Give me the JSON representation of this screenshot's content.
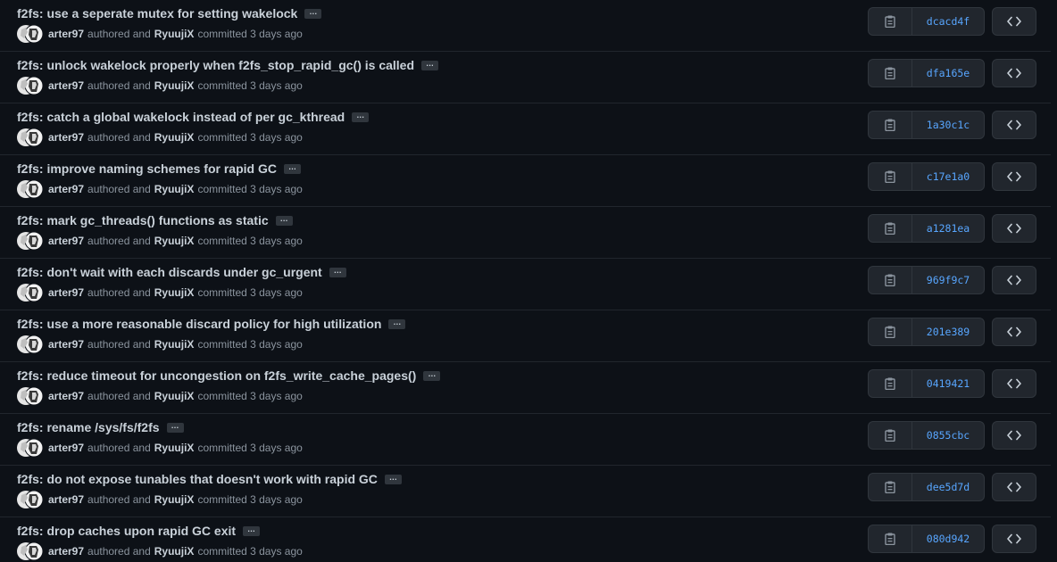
{
  "commits": [
    {
      "title": "f2fs: use a seperate mutex for setting wakelock",
      "author": "arter97",
      "authored_text": "authored and",
      "committer": "RyuujiX",
      "committed_text": "committed 3 days ago",
      "sha": "dcacd4f"
    },
    {
      "title": "f2fs: unlock wakelock properly when f2fs_stop_rapid_gc() is called",
      "author": "arter97",
      "authored_text": "authored and",
      "committer": "RyuujiX",
      "committed_text": "committed 3 days ago",
      "sha": "dfa165e"
    },
    {
      "title": "f2fs: catch a global wakelock instead of per gc_kthread",
      "author": "arter97",
      "authored_text": "authored and",
      "committer": "RyuujiX",
      "committed_text": "committed 3 days ago",
      "sha": "1a30c1c"
    },
    {
      "title": "f2fs: improve naming schemes for rapid GC",
      "author": "arter97",
      "authored_text": "authored and",
      "committer": "RyuujiX",
      "committed_text": "committed 3 days ago",
      "sha": "c17e1a0"
    },
    {
      "title": "f2fs: mark gc_threads() functions as static",
      "author": "arter97",
      "authored_text": "authored and",
      "committer": "RyuujiX",
      "committed_text": "committed 3 days ago",
      "sha": "a1281ea"
    },
    {
      "title": "f2fs: don't wait with each discards under gc_urgent",
      "author": "arter97",
      "authored_text": "authored and",
      "committer": "RyuujiX",
      "committed_text": "committed 3 days ago",
      "sha": "969f9c7"
    },
    {
      "title": "f2fs: use a more reasonable discard policy for high utilization",
      "author": "arter97",
      "authored_text": "authored and",
      "committer": "RyuujiX",
      "committed_text": "committed 3 days ago",
      "sha": "201e389"
    },
    {
      "title": "f2fs: reduce timeout for uncongestion on f2fs_write_cache_pages()",
      "author": "arter97",
      "authored_text": "authored and",
      "committer": "RyuujiX",
      "committed_text": "committed 3 days ago",
      "sha": "0419421"
    },
    {
      "title": "f2fs: rename /sys/fs/f2fs",
      "author": "arter97",
      "authored_text": "authored and",
      "committer": "RyuujiX",
      "committed_text": "committed 3 days ago",
      "sha": "0855cbc"
    },
    {
      "title": "f2fs: do not expose tunables that doesn't work with rapid GC",
      "author": "arter97",
      "authored_text": "authored and",
      "committer": "RyuujiX",
      "committed_text": "committed 3 days ago",
      "sha": "dee5d7d"
    },
    {
      "title": "f2fs: drop caches upon rapid GC exit",
      "author": "arter97",
      "authored_text": "authored and",
      "committer": "RyuujiX",
      "committed_text": "committed 3 days ago",
      "sha": "080d942"
    }
  ],
  "ui": {
    "ellipsis_label": "…",
    "colors": {
      "background": "#0d1117",
      "border": "#21262d",
      "button_bg": "#21262d",
      "sha_link": "#58a6ff",
      "muted_text": "#8b949e",
      "primary_text": "#c9d1d9"
    },
    "icons": {
      "avatar": "avatar-image",
      "copy": "clipboard-icon",
      "browse": "code-icon"
    }
  }
}
